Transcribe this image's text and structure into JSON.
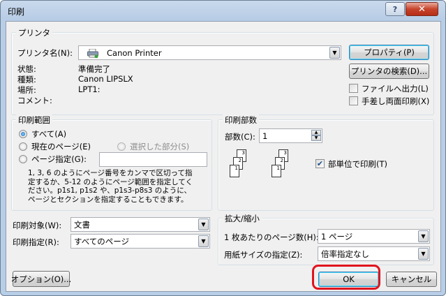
{
  "window": {
    "title": "印刷"
  },
  "printer": {
    "group_label": "プリンタ",
    "name_label": "プリンタ名(N):",
    "name_value": "Canon Printer",
    "properties_button": "プロパティ(P)",
    "find_button": "プリンタの検索(D)...",
    "status_label": "状態:",
    "status_value": "準備完了",
    "type_label": "種類:",
    "type_value": "Canon LIPSLX",
    "where_label": "場所:",
    "where_value": "LPT1:",
    "comment_label": "コメント:",
    "print_to_file": "ファイルへ出力(L)",
    "manual_duplex": "手差し両面印刷(X)"
  },
  "range": {
    "group_label": "印刷範囲",
    "all": "すべて(A)",
    "current_page": "現在のページ(E)",
    "selection": "選択した部分(S)",
    "pages": "ページ指定(G):",
    "pages_value": "",
    "help_text": [
      "1, 3, 6 のようにページ番号をカンマで区切って指",
      "定するか、5-12 のようにページ範囲を指定してく",
      "ださい。p1s1, p1s2 や、p1s3-p8s3 のように、",
      "ページとセクションを指定することもできます。"
    ]
  },
  "copies": {
    "group_label": "印刷部数",
    "count_label": "部数(C):",
    "count_value": "1",
    "collate": "部単位で印刷(T)",
    "collate_checked": true,
    "page_numbers": [
      "3",
      "2",
      "1",
      "3",
      "2",
      "1"
    ]
  },
  "print_what": {
    "label": "印刷対象(W):",
    "value": "文書"
  },
  "print_pages": {
    "label": "印刷指定(R):",
    "value": "すべてのページ"
  },
  "zoom": {
    "group_label": "拡大/縮小",
    "pages_per_sheet_label": "1 枚あたりのページ数(H):",
    "pages_per_sheet_value": "1 ページ",
    "scale_label": "用紙サイズの指定(Z):",
    "scale_value": "倍率指定なし"
  },
  "footer": {
    "options_button": "オプション(O)...",
    "ok_button": "OK",
    "cancel_button": "キャンセル"
  },
  "icons": {
    "help": "question-mark",
    "close": "x",
    "printer": "printer-icon",
    "dropdown": "chevron-down"
  },
  "colors": {
    "highlight": "#e0141e",
    "close_button": "#c7432c"
  }
}
